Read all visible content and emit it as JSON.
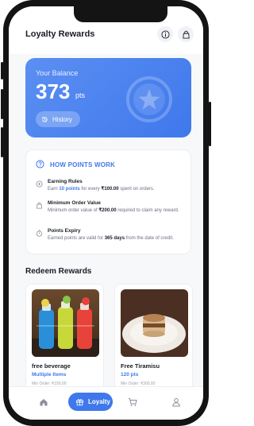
{
  "header": {
    "title": "Loyalty Rewards",
    "info_icon": "info-icon",
    "bag_icon": "shopping-bag-icon"
  },
  "balance": {
    "label": "Your Balance",
    "amount": "373",
    "unit": "pts",
    "history_label": "History",
    "history_icon": "history-icon",
    "badge_icon": "star-icon"
  },
  "how_points_work": {
    "title": "HOW POINTS WORK",
    "icon": "question-icon",
    "rules": [
      {
        "icon": "plus-circle-icon",
        "title": "Earning Rules",
        "pre": "Earn ",
        "highlight": "10 points",
        "mid": " for every ",
        "bold": "₹100.00",
        "post": " spent on orders."
      },
      {
        "icon": "bag-icon",
        "title": "Minimum Order Value",
        "pre": "Minimum order value of ",
        "bold": "₹200.00",
        "post": " required to claim any reward."
      },
      {
        "icon": "timer-icon",
        "title": "Points Expiry",
        "pre": "Earned points are valid for ",
        "bold": "365 days",
        "post": " from the date of credit."
      }
    ]
  },
  "redeem": {
    "title": "Redeem Rewards",
    "rewards": [
      {
        "name": "free beverage",
        "points": "Multiple Items",
        "min_order": "Min Order: ₹150.00"
      },
      {
        "name": "Free Tiramisu",
        "points": "120 pts",
        "min_order": "Min Order: ₹300.00"
      }
    ]
  },
  "nav": {
    "items": [
      "home-icon",
      "loyalty-icon",
      "cart-icon",
      "profile-icon"
    ],
    "active_label": "Loyalty"
  },
  "colors": {
    "accent": "#3f78ec",
    "card_gradient_start": "#5b8ff2",
    "background": "#f7f8fa"
  }
}
